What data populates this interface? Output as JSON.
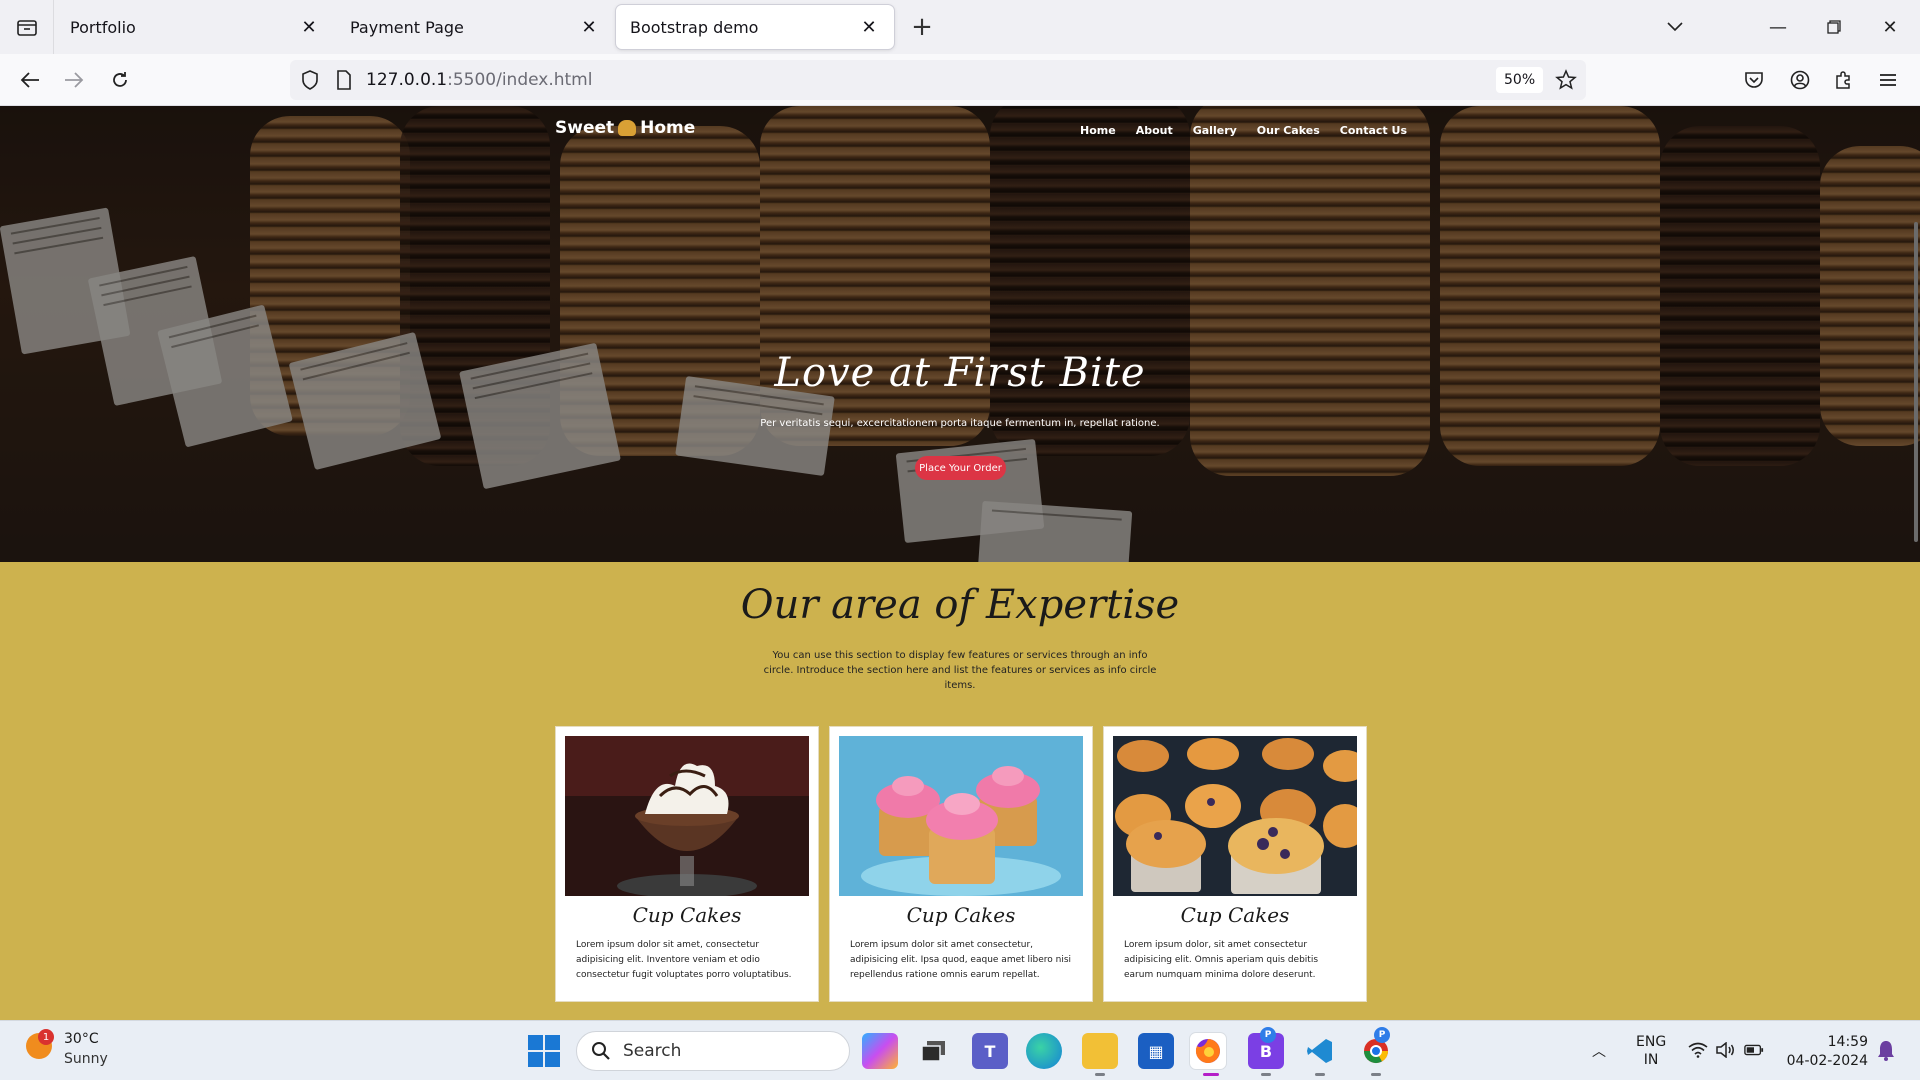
{
  "browser": {
    "tabs": [
      {
        "title": "Portfolio",
        "active": false
      },
      {
        "title": "Payment Page",
        "active": false
      },
      {
        "title": "Bootstrap demo",
        "active": true
      }
    ],
    "url_host": "127.0.0.1",
    "url_rest": ":5500/index.html",
    "zoom": "50%",
    "icons": [
      "tab-list-icon",
      "close-icon",
      "plus-icon",
      "chevron-down-icon",
      "minimize-icon",
      "restore-icon",
      "back-icon",
      "forward-icon",
      "reload-icon",
      "shield-icon",
      "page-icon",
      "star-icon",
      "pocket-icon",
      "account-icon",
      "extensions-icon",
      "menu-icon"
    ]
  },
  "site": {
    "brand_left": "Sweet",
    "brand_right": "Home",
    "nav": [
      "Home",
      "About",
      "Gallery",
      "Our Cakes",
      "Contact Us"
    ],
    "hero": {
      "title": "Love at First Bite",
      "subtitle": "Per veritatis sequi, excercitationem porta itaque fermentum in, repellat ratione.",
      "button": "Place Your Order"
    },
    "expertise": {
      "title": "Our area of Expertise",
      "description": "You can use this section to display few features or services through an info circle. Introduce the section here and list the features or services as info circle items."
    },
    "cards": [
      {
        "title": "Cup Cakes",
        "text": "Lorem ipsum dolor sit amet, consectetur adipisicing elit. Inventore veniam et odio consectetur fugit voluptates porro voluptatibus."
      },
      {
        "title": "Cup Cakes",
        "text": "Lorem ipsum dolor sit amet consectetur, adipisicing elit. Ipsa quod, eaque amet libero nisi repellendus ratione omnis earum repellat."
      },
      {
        "title": "Cup Cakes",
        "text": "Lorem ipsum dolor, sit amet consectetur adipisicing elit. Omnis aperiam quis debitis earum numquam minima dolore deserunt."
      }
    ],
    "colors": {
      "hero_dark": "#2a1c14",
      "expertise_bg": "#cdb24e",
      "button": "#dc3545"
    }
  },
  "taskbar": {
    "weather_badge": "1",
    "temperature": "30°C",
    "condition": "Sunny",
    "search_label": "Search",
    "lang_top": "ENG",
    "lang_bottom": "IN",
    "time": "14:59",
    "date": "04-02-2024",
    "badge_letter": "P",
    "apps": [
      "copilot-icon",
      "task-view-icon",
      "teams-icon",
      "edge-icon",
      "file-explorer-icon",
      "store-icon",
      "firefox-icon",
      "bootstrap-icon",
      "vscode-icon",
      "chrome-icon"
    ]
  }
}
